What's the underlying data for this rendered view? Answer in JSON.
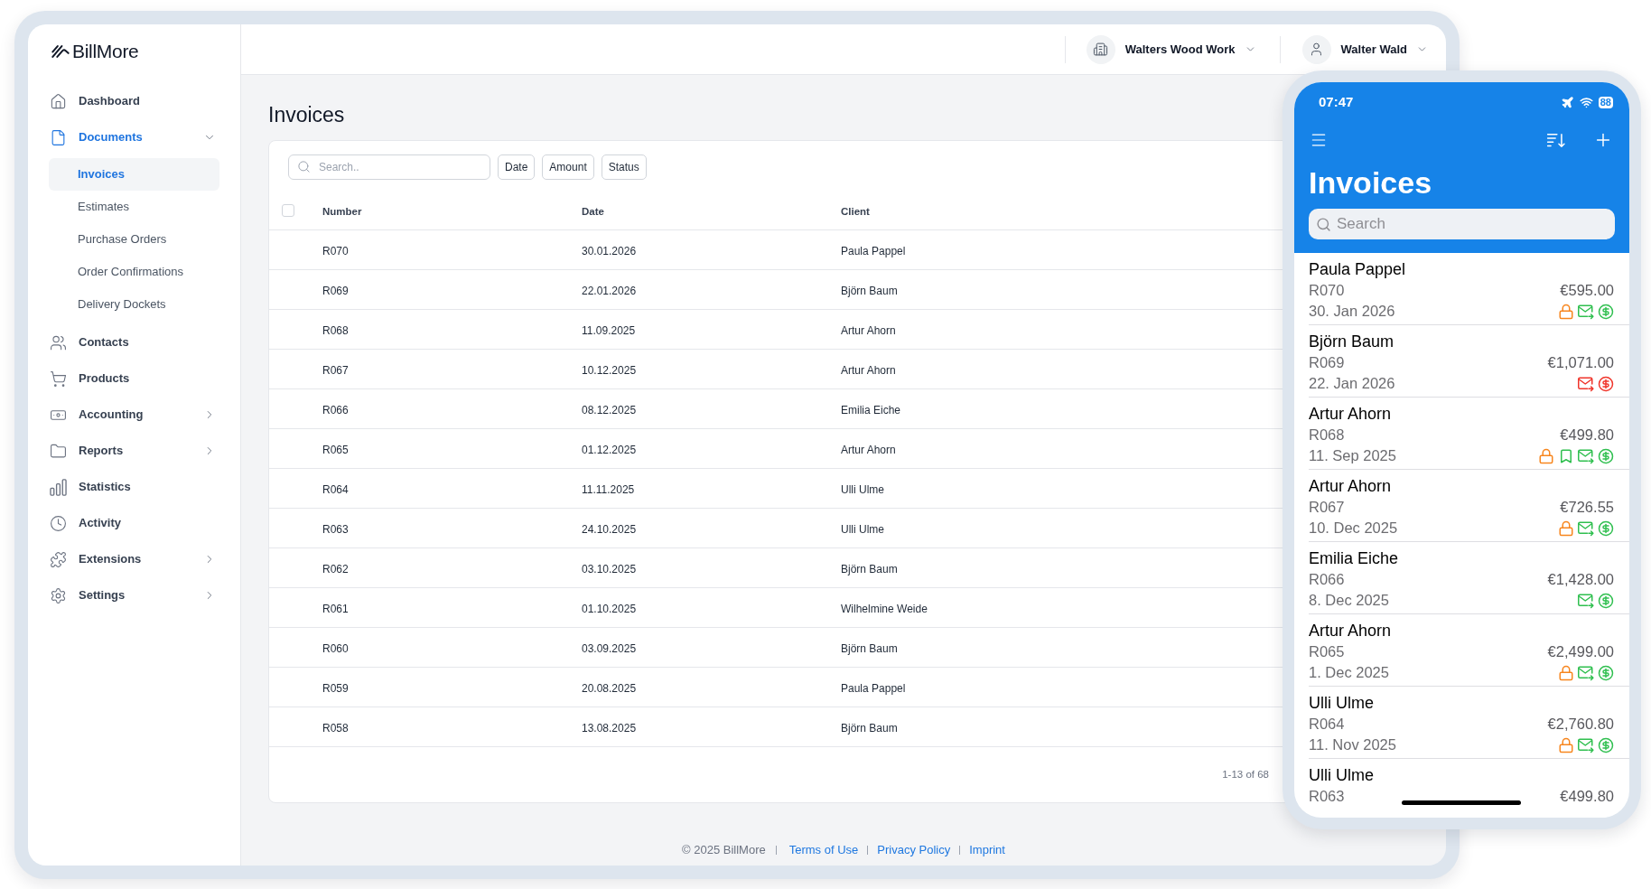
{
  "sidebar": {
    "logo": "BillMore",
    "items": [
      {
        "label": "Dashboard",
        "kind": "link",
        "selected": false
      },
      {
        "label": "Documents",
        "kind": "group",
        "selected": true,
        "expanded": true,
        "children": [
          {
            "label": "Invoices",
            "selected": true
          },
          {
            "label": "Estimates",
            "selected": false
          },
          {
            "label": "Purchase Orders",
            "selected": false
          },
          {
            "label": "Order Confirmations",
            "selected": false
          },
          {
            "label": "Delivery Dockets",
            "selected": false
          }
        ]
      },
      {
        "label": "Contacts",
        "kind": "link",
        "selected": false
      },
      {
        "label": "Products",
        "kind": "link",
        "selected": false
      },
      {
        "label": "Accounting",
        "kind": "group",
        "selected": false,
        "expanded": false
      },
      {
        "label": "Reports",
        "kind": "group",
        "selected": false,
        "expanded": false
      },
      {
        "label": "Statistics",
        "kind": "link",
        "selected": false
      },
      {
        "label": "Activity",
        "kind": "link",
        "selected": false
      },
      {
        "label": "Extensions",
        "kind": "group",
        "selected": false,
        "expanded": false
      },
      {
        "label": "Settings",
        "kind": "group",
        "selected": false,
        "expanded": false
      }
    ]
  },
  "top_bar": {
    "company": "Walters Wood Work",
    "user": "Walter Wald"
  },
  "page": {
    "title": "Invoices"
  },
  "filters": {
    "search": {
      "placeholder": "Search.."
    },
    "buttons": [
      "Date",
      "Amount",
      "Status"
    ]
  },
  "table": {
    "select_all": {
      "checked": false
    },
    "columns": [
      "Number",
      "Date",
      "Client"
    ],
    "rows": [
      [
        "R070",
        "30.01.2026",
        "Paula Pappel"
      ],
      [
        "R069",
        "22.01.2026",
        "Björn Baum"
      ],
      [
        "R068",
        "11.09.2025",
        "Artur Ahorn"
      ],
      [
        "R067",
        "10.12.2025",
        "Artur Ahorn"
      ],
      [
        "R066",
        "08.12.2025",
        "Emilia Eiche"
      ],
      [
        "R065",
        "01.12.2025",
        "Artur Ahorn"
      ],
      [
        "R064",
        "11.11.2025",
        "Ulli Ulme"
      ],
      [
        "R063",
        "24.10.2025",
        "Ulli Ulme"
      ],
      [
        "R062",
        "03.10.2025",
        "Björn Baum"
      ],
      [
        "R061",
        "01.10.2025",
        "Wilhelmine Weide"
      ],
      [
        "R060",
        "03.09.2025",
        "Björn Baum"
      ],
      [
        "R059",
        "20.08.2025",
        "Paula Pappel"
      ],
      [
        "R058",
        "13.08.2025",
        "Björn Baum"
      ]
    ],
    "pagination": "1-13 of 68"
  },
  "footer": {
    "copyright": "© 2025 BillMore",
    "links": [
      "Terms of Use",
      "Privacy Policy",
      "Imprint"
    ]
  },
  "phone": {
    "status_bar": {
      "time": "07:47",
      "battery": "88"
    },
    "title": "Invoices",
    "search": {
      "placeholder": "Search"
    },
    "invoices": [
      {
        "name": "Paula Pappel",
        "number": "R070",
        "amount": "€595.00",
        "date": "30. Jan 2026",
        "statuses": [
          {
            "kind": "locked",
            "color": "#f7861e"
          },
          {
            "kind": "sent",
            "color": "#2fbf4f"
          },
          {
            "kind": "paid",
            "color": "#2fbf4f"
          }
        ]
      },
      {
        "name": "Björn Baum",
        "number": "R069",
        "amount": "€1,071.00",
        "date": "22. Jan 2026",
        "statuses": [
          {
            "kind": "sent",
            "color": "#f0352b"
          },
          {
            "kind": "paid",
            "color": "#f0352b"
          }
        ]
      },
      {
        "name": "Artur Ahorn",
        "number": "R068",
        "amount": "€499.80",
        "date": "11. Sep 2025",
        "statuses": [
          {
            "kind": "locked",
            "color": "#f7861e"
          },
          {
            "kind": "bookmarked",
            "color": "#2fbf4f"
          },
          {
            "kind": "sent",
            "color": "#2fbf4f"
          },
          {
            "kind": "paid",
            "color": "#2fbf4f"
          }
        ]
      },
      {
        "name": "Artur Ahorn",
        "number": "R067",
        "amount": "€726.55",
        "date": "10. Dec 2025",
        "statuses": [
          {
            "kind": "locked",
            "color": "#f7861e"
          },
          {
            "kind": "sent",
            "color": "#2fbf4f"
          },
          {
            "kind": "paid",
            "color": "#2fbf4f"
          }
        ]
      },
      {
        "name": "Emilia Eiche",
        "number": "R066",
        "amount": "€1,428.00",
        "date": "8. Dec 2025",
        "statuses": [
          {
            "kind": "sent",
            "color": "#2fbf4f"
          },
          {
            "kind": "paid",
            "color": "#2fbf4f"
          }
        ]
      },
      {
        "name": "Artur Ahorn",
        "number": "R065",
        "amount": "€2,499.00",
        "date": "1. Dec 2025",
        "statuses": [
          {
            "kind": "locked",
            "color": "#f7861e"
          },
          {
            "kind": "sent",
            "color": "#2fbf4f"
          },
          {
            "kind": "paid",
            "color": "#2fbf4f"
          }
        ]
      },
      {
        "name": "Ulli Ulme",
        "number": "R064",
        "amount": "€2,760.80",
        "date": "11. Nov 2025",
        "statuses": [
          {
            "kind": "locked",
            "color": "#f7861e"
          },
          {
            "kind": "sent",
            "color": "#2fbf4f"
          },
          {
            "kind": "paid",
            "color": "#2fbf4f"
          }
        ]
      },
      {
        "name": "Ulli Ulme",
        "number": "R063",
        "amount": "€499.80"
      }
    ]
  }
}
